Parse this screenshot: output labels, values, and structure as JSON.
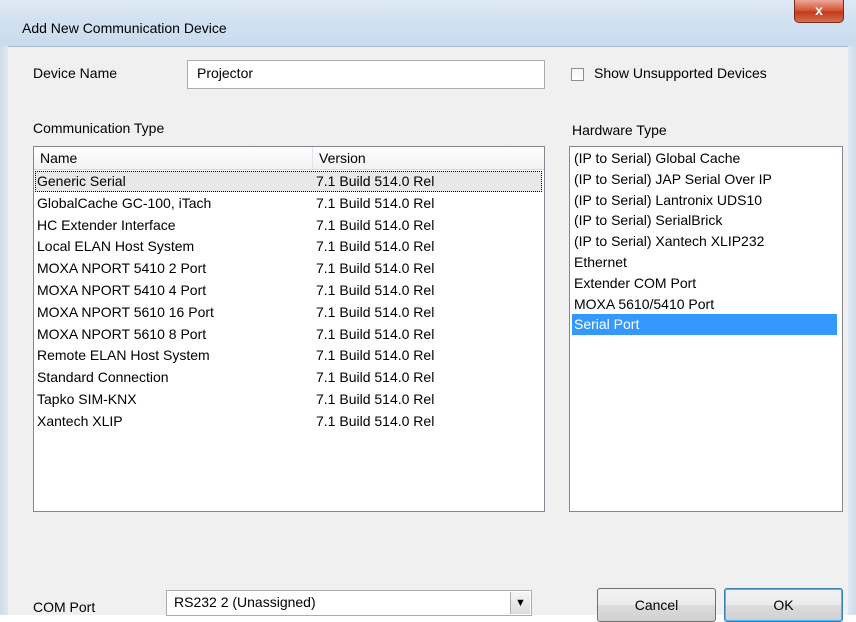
{
  "window": {
    "title": "Add New Communication Device",
    "close_glyph": "x"
  },
  "device_name": {
    "label": "Device Name",
    "value": "Projector"
  },
  "show_unsupported": {
    "label": "Show Unsupported Devices",
    "checked": false
  },
  "communication_type": {
    "label": "Communication Type",
    "columns": [
      "Name",
      "Version"
    ],
    "rows": [
      {
        "name": "Generic Serial",
        "version": "7.1 Build 514.0 Rel",
        "selected": true
      },
      {
        "name": "GlobalCache GC-100, iTach",
        "version": "7.1 Build 514.0 Rel"
      },
      {
        "name": "HC Extender Interface",
        "version": "7.1 Build 514.0 Rel"
      },
      {
        "name": "Local ELAN Host System",
        "version": "7.1 Build 514.0 Rel"
      },
      {
        "name": "MOXA NPORT 5410 2 Port",
        "version": "7.1 Build 514.0 Rel"
      },
      {
        "name": "MOXA NPORT 5410 4 Port",
        "version": "7.1 Build 514.0 Rel"
      },
      {
        "name": "MOXA NPORT 5610 16 Port",
        "version": "7.1 Build 514.0 Rel"
      },
      {
        "name": "MOXA NPORT 5610 8 Port",
        "version": "7.1 Build 514.0 Rel"
      },
      {
        "name": "Remote ELAN Host System",
        "version": "7.1 Build 514.0 Rel"
      },
      {
        "name": "Standard Connection",
        "version": "7.1 Build 514.0 Rel"
      },
      {
        "name": "Tapko SIM-KNX",
        "version": "7.1 Build 514.0 Rel"
      },
      {
        "name": "Xantech XLIP",
        "version": "7.1 Build 514.0 Rel"
      }
    ]
  },
  "hardware_type": {
    "label": "Hardware Type",
    "items": [
      {
        "label": "(IP to Serial) Global Cache"
      },
      {
        "label": "(IP to Serial) JAP Serial Over IP"
      },
      {
        "label": "(IP to Serial) Lantronix UDS10"
      },
      {
        "label": "(IP to Serial) SerialBrick"
      },
      {
        "label": "(IP to Serial) Xantech XLIP232"
      },
      {
        "label": "Ethernet"
      },
      {
        "label": "Extender COM Port"
      },
      {
        "label": "MOXA 5610/5410 Port"
      },
      {
        "label": "Serial Port",
        "selected": true
      }
    ]
  },
  "com_port": {
    "label": "COM Port",
    "value": "RS232 2 (Unassigned)",
    "dropdown_glyph": "▼"
  },
  "buttons": {
    "cancel": "Cancel",
    "ok": "OK"
  },
  "colors": {
    "selection_blue": "#3399ff",
    "title_bar": "#d3e2f2",
    "close_red": "#c23a1c"
  }
}
